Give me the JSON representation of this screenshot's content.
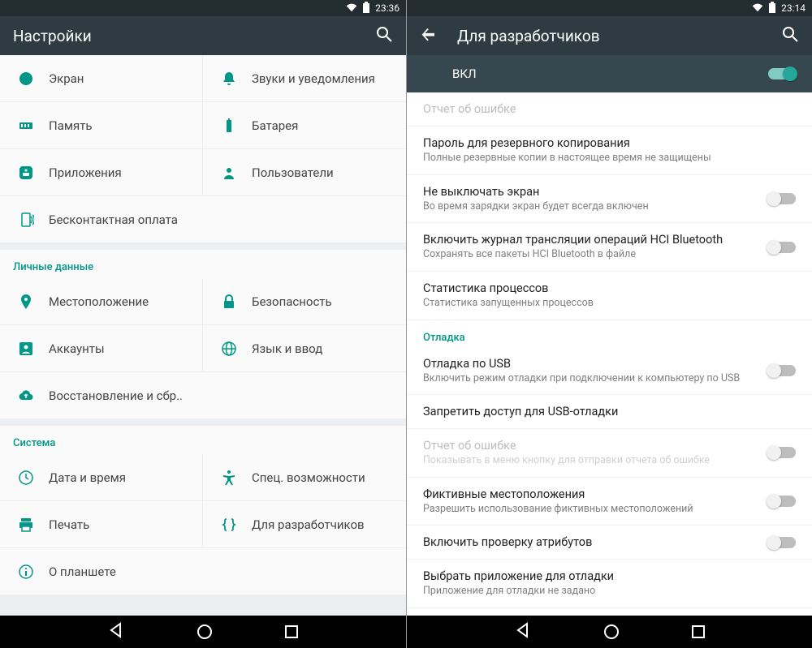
{
  "left": {
    "status_time": "23:36",
    "title": "Настройки",
    "device": [
      {
        "icon": "display",
        "label": "Экран"
      },
      {
        "icon": "bell",
        "label": "Звуки и уведомления"
      },
      {
        "icon": "memory",
        "label": "Память"
      },
      {
        "icon": "battery",
        "label": "Батарея"
      },
      {
        "icon": "apps",
        "label": "Приложения"
      },
      {
        "icon": "user",
        "label": "Пользователи"
      },
      {
        "icon": "nfc",
        "label": "Бесконтактная оплата",
        "full": true
      }
    ],
    "personal_header": "Личные данные",
    "personal": [
      {
        "icon": "location",
        "label": "Местоположение"
      },
      {
        "icon": "lock",
        "label": "Безопасность"
      },
      {
        "icon": "account",
        "label": "Аккаунты"
      },
      {
        "icon": "language",
        "label": "Язык и ввод"
      },
      {
        "icon": "backup",
        "label": "Восстановление и сбр..",
        "full": true
      }
    ],
    "system_header": "Система",
    "system": [
      {
        "icon": "clock",
        "label": "Дата и время"
      },
      {
        "icon": "accessibility",
        "label": "Спец. возможности"
      },
      {
        "icon": "print",
        "label": "Печать"
      },
      {
        "icon": "braces",
        "label": "Для разработчиков"
      },
      {
        "icon": "info",
        "label": "О планшете",
        "full": true
      }
    ]
  },
  "right": {
    "status_time": "23:14",
    "title": "Для разработчиков",
    "master_label": "ВКЛ",
    "items": [
      {
        "title": "Отчет об ошибке",
        "disabled": true
      },
      {
        "title": "Пароль для резервного копирования",
        "sub": "Полные резервные копии в настоящее время не защищены"
      },
      {
        "title": "Не выключать экран",
        "sub": "Во время зарядки экран будет всегда включен",
        "toggle": false
      },
      {
        "title": "Включить журнал трансляции операций HCI Bluetooth",
        "sub": "Сохранять все пакеты HCI Bluetooth в файле",
        "toggle": false
      },
      {
        "title": "Статистика процессов",
        "sub": "Статистика запущенных процессов"
      }
    ],
    "debug_header": "Отладка",
    "debug": [
      {
        "title": "Отладка по USB",
        "sub": "Включить режим отладки при подключении к компьютеру по USB",
        "toggle": false
      },
      {
        "title": "Запретить доступ для USB-отладки"
      },
      {
        "title": "Отчет об ошибке",
        "sub": "Показывать в меню кнопку для отправки отчета об ошибке",
        "toggle": false,
        "disabled": true
      },
      {
        "title": "Фиктивные местоположения",
        "sub": "Разрешить использование фиктивных местоположений",
        "toggle": false
      },
      {
        "title": "Включить проверку атрибутов",
        "toggle": false
      },
      {
        "title": "Выбрать приложение для отладки",
        "sub": "Приложение для отладки не задано"
      }
    ]
  }
}
